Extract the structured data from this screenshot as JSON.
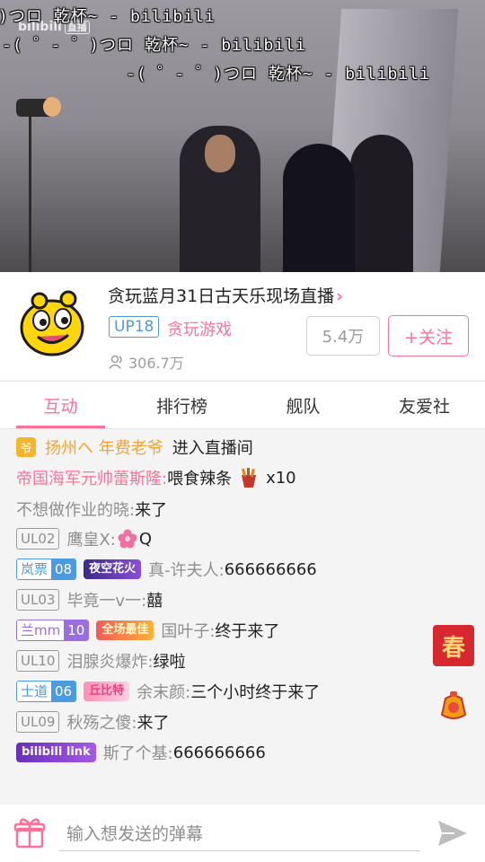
{
  "video": {
    "logo_text": "bilibili",
    "logo_tag": "直播",
    "danmaku": [
      ")つロ 乾杯~ - bilibili",
      "-( ゜- ゜)つロ 乾杯~ - bilibili",
      "-( ゜- ゜)つロ 乾杯~ - bilibili"
    ]
  },
  "room": {
    "title": "贪玩蓝月31日古天乐现场直播",
    "chevron": "›",
    "up_badge": "UP18",
    "category": "贪玩游戏",
    "viewers": "306.7万",
    "fans_count": "5.4万",
    "follow_label": "+关注"
  },
  "tabs": [
    "互动",
    "排行榜",
    "舰队",
    "友爱社"
  ],
  "chat": {
    "entry": {
      "icon": "爷",
      "name": "扬州へ 年费老爷",
      "text": "进入直播间"
    },
    "gift": {
      "name": "帝国海军元帅蕾斯隆:",
      "text": "喂食辣条",
      "count": "x10"
    },
    "m1": {
      "name": "不想做作业的晓:",
      "text": "来了"
    },
    "m2": {
      "level": "UL02",
      "name": "鹰皇X:",
      "text": "Q"
    },
    "m3": {
      "medal_name": "岚票",
      "medal_level": "08",
      "title_badge": "夜空花火",
      "name": "真-许夫人:",
      "text": "666666666"
    },
    "m4": {
      "level": "UL03",
      "name": "毕竟一v一:",
      "text": "囍"
    },
    "m5": {
      "medal_name": "兰mm",
      "medal_level": "10",
      "title_badge": "全场最佳",
      "name": "国叶子:",
      "text": "终于来了"
    },
    "m6": {
      "level": "UL10",
      "name": "泪腺炎爆炸:",
      "text": "绿啦"
    },
    "m7": {
      "medal_name": "士道",
      "medal_level": "06",
      "title_badge": "丘比特",
      "name": "余末颜:",
      "text": "三个小时终于来了"
    },
    "m8": {
      "level": "UL09",
      "name": "秋殇之傻:",
      "text": "来了"
    },
    "m9": {
      "title_badge": "bilibili link",
      "name": "斯了个基:",
      "text": "666666666"
    }
  },
  "floating": {
    "chun": "春"
  },
  "input": {
    "placeholder": "输入想发送的弹幕"
  },
  "colors": {
    "accent": "#fb7299",
    "blue": "#4b9be0",
    "purple": "#9b6ee0"
  }
}
